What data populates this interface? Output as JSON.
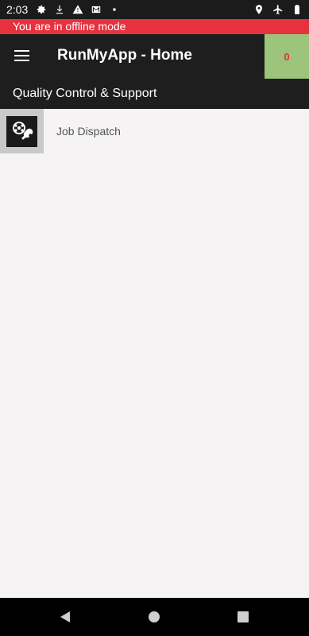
{
  "status_bar": {
    "time": "2:03",
    "left_icons": [
      "gear-icon",
      "download-icon",
      "warning-icon",
      "gmail-icon",
      "dot-icon"
    ],
    "right_icons": [
      "location-icon",
      "airplane-icon",
      "battery-icon"
    ]
  },
  "banner": {
    "text": "You are in offline mode",
    "color": "#e6323f"
  },
  "app_bar": {
    "title": "RunMyApp - Home",
    "counter": "0",
    "counter_bg": "#9cc47a"
  },
  "section": {
    "title": "Quality Control & Support"
  },
  "list": {
    "items": [
      {
        "label": "Job Dispatch",
        "icon": "dispatch-tools-icon"
      }
    ]
  },
  "nav_bar": {
    "buttons": [
      "back",
      "home",
      "recents"
    ]
  }
}
